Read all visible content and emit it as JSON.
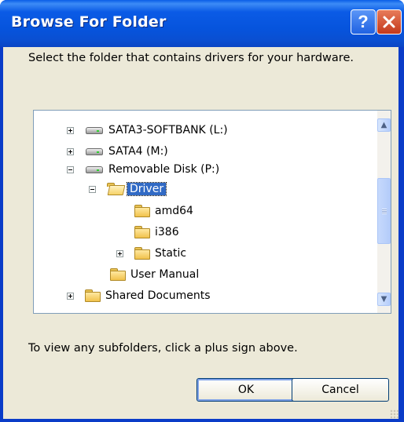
{
  "window": {
    "title": "Browse For Folder",
    "help_label": "?",
    "close_label": "×"
  },
  "prompt": "Select the folder that contains drivers for your hardware.",
  "tree": {
    "items": [
      {
        "label": "SATA3-SOFTBANK (L:)",
        "type": "drive",
        "expander": "plus"
      },
      {
        "label": "SATA4 (M:)",
        "type": "drive",
        "expander": "plus"
      },
      {
        "label": "Removable Disk (P:)",
        "type": "drive",
        "expander": "minus"
      },
      {
        "label": "Driver",
        "type": "folder-open",
        "expander": "minus",
        "selected": true
      },
      {
        "label": "amd64",
        "type": "folder",
        "expander": "none"
      },
      {
        "label": "i386",
        "type": "folder",
        "expander": "none"
      },
      {
        "label": "Static",
        "type": "folder",
        "expander": "plus"
      },
      {
        "label": "User Manual",
        "type": "folder",
        "expander": "none"
      },
      {
        "label": "Shared Documents",
        "type": "folder",
        "expander": "plus"
      }
    ]
  },
  "hint": "To view any subfolders, click a plus sign above.",
  "buttons": {
    "ok": "OK",
    "cancel": "Cancel"
  },
  "colors": {
    "title_blue": "#0a5ee8",
    "dialog_bg": "#ece9d8",
    "selection": "#316ac5"
  },
  "icons": {
    "drive": "hard-drive-icon",
    "folder": "folder-icon",
    "folder_open": "folder-open-icon",
    "expand": "plus-box-icon",
    "collapse": "minus-box-icon"
  }
}
